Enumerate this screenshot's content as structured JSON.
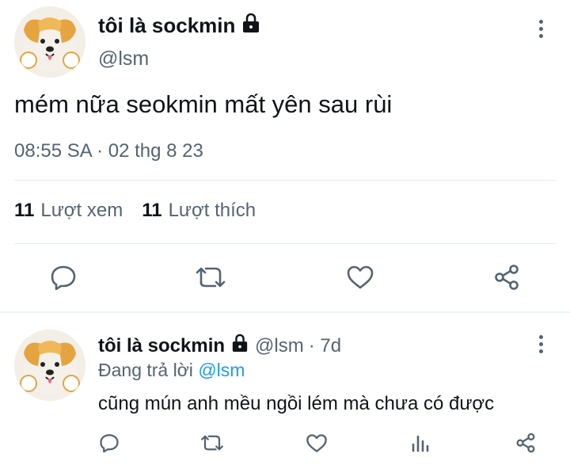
{
  "main_tweet": {
    "display_name": "tôi là sockmin",
    "handle": "@lsm",
    "text": "mém nữa seokmin mất yên sau rùi",
    "timestamp": "08:55 SA · 02 thg 8 23",
    "views_count": "11",
    "views_label": "Lượt xem",
    "likes_count": "11",
    "likes_label": "Lượt thích",
    "actions": [
      "reply-icon",
      "retweet-icon",
      "like-icon",
      "share-icon"
    ]
  },
  "reply_tweet": {
    "display_name": "tôi là sockmin",
    "handle": "@lsm",
    "age": "· 7d",
    "replying_prefix": "Đang trả lời",
    "replying_handle": "@lsm",
    "text": "cũng mún anh mều ngồi lém mà chưa có được",
    "actions": [
      "reply-icon",
      "retweet-icon",
      "like-icon",
      "views-icon",
      "share-icon"
    ]
  },
  "colors": {
    "text": "#0f1419",
    "secondary": "#536471",
    "link": "#1d9bf0",
    "divider": "#e6ecf0"
  }
}
